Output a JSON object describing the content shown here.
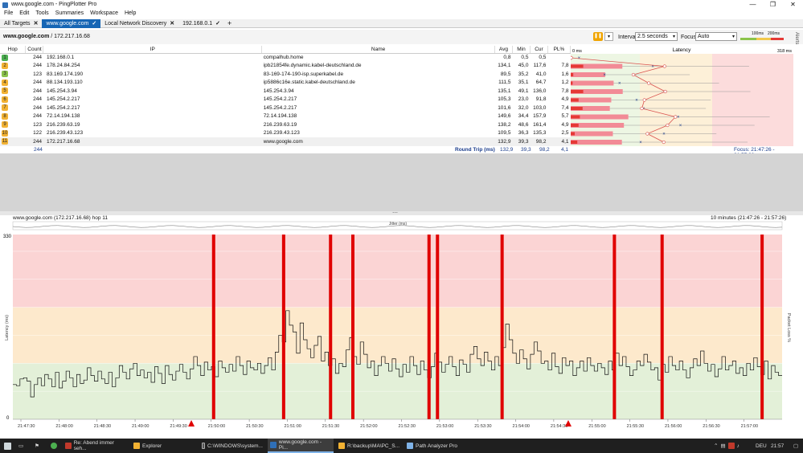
{
  "window": {
    "title": "www.google.com - PingPlotter Pro",
    "minimize": "—",
    "maximize": "❐",
    "close": "✕"
  },
  "menu": [
    "File",
    "Edit",
    "Tools",
    "Summaries",
    "Workspace",
    "Help"
  ],
  "tabs": [
    {
      "label": "All Targets",
      "close": "✕",
      "active": false
    },
    {
      "label": "www.google.com",
      "close": "✓",
      "active": true
    },
    {
      "label": "Local Network Discovery",
      "close": "✕",
      "active": false
    },
    {
      "label": "192.168.0.1",
      "close": "✓",
      "active": false
    }
  ],
  "add_tab": "+",
  "toolbar": {
    "target_host": "www.google.com",
    "target_ip": " / 172.217.16.68",
    "interval_label": "Interval",
    "interval_value": "2.5 seconds",
    "focus_label": "Focus",
    "focus_value": "Auto",
    "scale_100": "100ms",
    "scale_200": "200ms",
    "alerts": "Alerts"
  },
  "table": {
    "headers": {
      "hop": "Hop",
      "count": "Count",
      "ip": "IP",
      "name": "Name",
      "avg": "Avg",
      "min": "Min",
      "cur": "Cur",
      "pl": "PL%",
      "latency": "Latency",
      "lat_min": "0 ms",
      "lat_max": "318 ms"
    },
    "rows": [
      {
        "hop": "1",
        "count": "244",
        "ip": "192.168.0.1",
        "name": "compalhub.home",
        "avg": "0,8",
        "min": "0,5",
        "cur": "0,5",
        "pl": "",
        "color": "#4caf50"
      },
      {
        "hop": "2",
        "count": "244",
        "ip": "178.24.84.254",
        "name": "ipb21854fe.dynamic.kabel-deutschland.de",
        "avg": "134,1",
        "min": "45,0",
        "cur": "117,6",
        "pl": "7,8",
        "color": "#f2b233"
      },
      {
        "hop": "3",
        "count": "123",
        "ip": "83.169.174.190",
        "name": "83-169-174-190-isp.superkabel.de",
        "avg": "89,5",
        "min": "35,2",
        "cur": "41,0",
        "pl": "1,6",
        "color": "#8bc34a"
      },
      {
        "hop": "4",
        "count": "244",
        "ip": "88.134.193.110",
        "name": "ip5886c16e.static.kabel-deutschland.de",
        "avg": "111,5",
        "min": "35,1",
        "cur": "64,7",
        "pl": "1,2",
        "color": "#f2b233"
      },
      {
        "hop": "5",
        "count": "244",
        "ip": "145.254.3.94",
        "name": "145.254.3.94",
        "avg": "135,1",
        "min": "49,1",
        "cur": "136,0",
        "pl": "7,8",
        "color": "#f2b233"
      },
      {
        "hop": "6",
        "count": "244",
        "ip": "145.254.2.217",
        "name": "145.254.2.217",
        "avg": "105,3",
        "min": "23,0",
        "cur": "91,8",
        "pl": "4,9",
        "color": "#f2b233"
      },
      {
        "hop": "7",
        "count": "244",
        "ip": "145.254.2.217",
        "name": "145.254.2.217",
        "avg": "101,6",
        "min": "32,0",
        "cur": "103,0",
        "pl": "7,4",
        "color": "#f2b233"
      },
      {
        "hop": "8",
        "count": "244",
        "ip": "72.14.194.138",
        "name": "72.14.194.138",
        "avg": "149,6",
        "min": "34,4",
        "cur": "157,9",
        "pl": "5,7",
        "color": "#f2b233"
      },
      {
        "hop": "9",
        "count": "123",
        "ip": "216.239.63.19",
        "name": "216.239.63.19",
        "avg": "138,2",
        "min": "48,6",
        "cur": "161,4",
        "pl": "4,9",
        "color": "#f2b233"
      },
      {
        "hop": "10",
        "count": "122",
        "ip": "216.239.43.123",
        "name": "216.239.43.123",
        "avg": "109,5",
        "min": "36,3",
        "cur": "135,3",
        "pl": "2,5",
        "color": "#f2b233"
      },
      {
        "hop": "11",
        "count": "244",
        "ip": "172.217.16.68",
        "name": "www.google.com",
        "avg": "132,9",
        "min": "39,3",
        "cur": "98,2",
        "pl": "4,1",
        "color": "#f2b233"
      }
    ],
    "summary": {
      "count": "244",
      "label": "Round Trip (ms)",
      "avg": "132,9",
      "min": "39,3",
      "cur": "98,2",
      "pl": "4,1",
      "focus": "Focus: 21:47:26 - 21:57:26"
    }
  },
  "timeline": {
    "header_left": "www.google.com (172.217.16.68) hop 11",
    "header_right": "10 minutes (21:47:26 - 21:57:26)",
    "jitter_label": "Jitter (ms)",
    "y_label": "Latency (ms)",
    "y2_label": "Packet Loss %",
    "y_max": "330",
    "y_zero": "0",
    "x_ticks": [
      "21:47:30",
      "21:48:00",
      "21:48:30",
      "21:49:00",
      "21:49:30",
      "21:50:00",
      "21:50:30",
      "21:51:00",
      "21:51:30",
      "21:52:00",
      "21:52:30",
      "21:53:00",
      "21:53:30",
      "21:54:00",
      "21:54:30",
      "21:55:00",
      "21:55:30",
      "21:56:00",
      "21:56:30",
      "21:57:00"
    ],
    "loss_x_fracs": [
      0.261,
      0.352,
      0.413,
      0.442,
      0.541,
      0.552,
      0.636,
      0.782,
      0.844,
      0.974
    ],
    "marker_x_fracs": [
      0.232,
      0.722
    ],
    "zones": {
      "red": "#fbd4d4",
      "orange": "#fde9cc",
      "green": "#e3f0d8"
    },
    "latency_series": [
      62,
      60,
      72,
      74,
      68,
      40,
      62,
      74,
      60,
      80,
      72,
      58,
      84,
      56,
      68,
      86,
      74,
      58,
      80,
      64,
      70,
      92,
      78,
      68,
      86,
      72,
      64,
      84,
      58,
      74,
      96,
      84,
      72,
      90,
      100,
      78,
      88,
      74,
      84,
      66,
      94,
      82,
      64,
      96,
      80,
      70,
      86,
      98,
      84,
      72,
      90,
      112,
      96,
      78,
      102,
      88,
      94,
      76,
      104,
      92,
      84,
      98,
      86,
      112,
      96,
      80,
      104,
      92,
      88,
      100,
      82,
      96,
      110,
      88,
      120,
      150,
      138,
      194,
      168,
      156,
      118,
      172,
      142,
      126,
      110,
      132,
      148,
      104,
      120,
      96,
      108,
      82,
      100,
      94,
      124,
      146,
      112,
      98,
      138,
      116,
      92,
      104,
      78,
      96,
      112,
      100,
      86,
      108,
      90,
      76,
      98,
      84,
      112,
      96,
      80,
      104,
      88,
      74,
      94,
      118,
      102,
      84,
      98,
      112,
      94,
      78,
      106,
      98,
      84,
      116,
      130,
      108,
      96,
      120,
      104,
      88,
      112,
      96,
      128,
      170,
      142,
      118,
      100,
      124,
      108,
      90,
      116,
      138,
      122,
      100,
      104,
      88,
      118,
      94,
      82,
      110,
      96,
      104,
      78,
      92,
      104,
      86,
      110,
      96,
      86,
      100,
      92,
      80,
      104,
      88,
      118,
      96,
      112,
      94,
      78,
      88,
      104,
      96,
      116,
      102,
      88,
      92,
      70,
      98,
      84,
      112,
      96,
      88,
      104,
      88,
      74,
      92,
      108,
      96,
      122,
      100,
      86,
      98,
      76,
      90,
      112,
      88,
      96,
      104,
      82,
      92,
      78,
      100,
      88,
      110,
      94,
      80,
      104,
      72,
      96,
      84,
      78
    ]
  },
  "taskbar": {
    "items": [
      {
        "label": "Re: Abend immer seh...",
        "active": false
      },
      {
        "label": "Explorer",
        "active": false
      },
      {
        "label": "C:\\WINDOWS\\system...",
        "active": false
      },
      {
        "label": "www.google.com - Pi...",
        "active": true
      },
      {
        "label": "R:\\backup\\MA\\PC_S...",
        "active": false
      },
      {
        "label": "Path Analyzer Pro",
        "active": false
      }
    ],
    "lang": "DEU",
    "time": "21:57"
  }
}
